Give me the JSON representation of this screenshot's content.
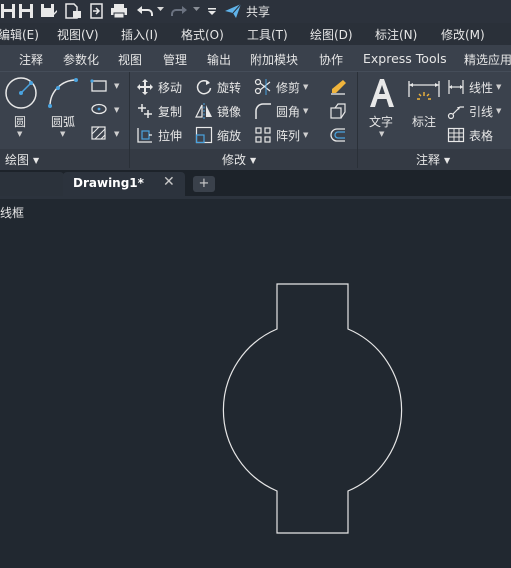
{
  "quick_access": {
    "share_label": "共享",
    "icons": [
      "save-icon",
      "save-as-icon",
      "publish-icon",
      "export-icon",
      "plot-icon",
      "undo-icon",
      "redo-icon",
      "customize-icon",
      "share-icon"
    ]
  },
  "menubar": {
    "items": [
      "编辑(E)",
      "视图(V)",
      "插入(I)",
      "格式(O)",
      "工具(T)",
      "绘图(D)",
      "标注(N)",
      "修改(M)"
    ]
  },
  "ribbon_tabs": {
    "items": [
      "注释",
      "参数化",
      "视图",
      "管理",
      "输出",
      "附加模块",
      "协作",
      "Express Tools",
      "精选应用"
    ]
  },
  "ribbon": {
    "draw_panel": {
      "circle_label": "圆",
      "arc_label": "圆弧",
      "title": "绘图"
    },
    "modify_panel": {
      "move": "移动",
      "rotate": "旋转",
      "trim": "修剪",
      "copy": "复制",
      "mirror": "镜像",
      "fillet": "圆角",
      "stretch": "拉伸",
      "scale": "缩放",
      "array": "阵列",
      "title": "修改"
    },
    "annotation_panel": {
      "text_label": "文字",
      "dimension_label": "标注",
      "linear": "线性",
      "leader": "引线",
      "table": "表格",
      "title": "注释"
    }
  },
  "file_tabs": {
    "active": "Drawing1*",
    "close_glyph": "✕",
    "new_glyph": "+"
  },
  "canvas": {
    "viewport_label": "线框"
  }
}
